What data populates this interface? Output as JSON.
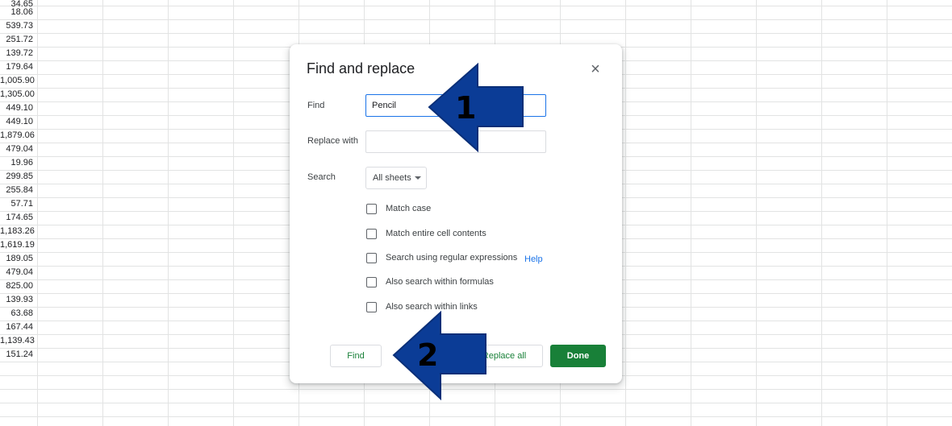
{
  "sheet": {
    "partial_value": "34.65",
    "column_a_values": [
      "18.06",
      "539.73",
      "251.72",
      "139.72",
      "179.64",
      "1,005.90",
      "1,305.00",
      "449.10",
      "449.10",
      "1,879.06",
      "479.04",
      "19.96",
      "299.85",
      "255.84",
      "57.71",
      "174.65",
      "1,183.26",
      "1,619.19",
      "189.05",
      "479.04",
      "825.00",
      "139.93",
      "63.68",
      "167.44",
      "1,139.43",
      "151.24"
    ]
  },
  "dialog": {
    "title": "Find and replace",
    "close_icon": "close-icon",
    "find_label": "Find",
    "find_value": "Pencil",
    "replace_label": "Replace with",
    "replace_value": "",
    "search_label": "Search",
    "search_selected": "All sheets",
    "options": [
      {
        "label": "Match case",
        "checked": false
      },
      {
        "label": "Match entire cell contents",
        "checked": false
      },
      {
        "label": "Search using regular expressions",
        "checked": false
      },
      {
        "label": "Also search within formulas",
        "checked": false
      },
      {
        "label": "Also search within links",
        "checked": false
      }
    ],
    "help_link": "Help",
    "buttons": {
      "find": "Find",
      "replace_all": "Replace all",
      "done": "Done"
    }
  },
  "annotations": {
    "arrow1_number": "1",
    "arrow2_number": "2",
    "arrow_color": "#0b3c96"
  }
}
